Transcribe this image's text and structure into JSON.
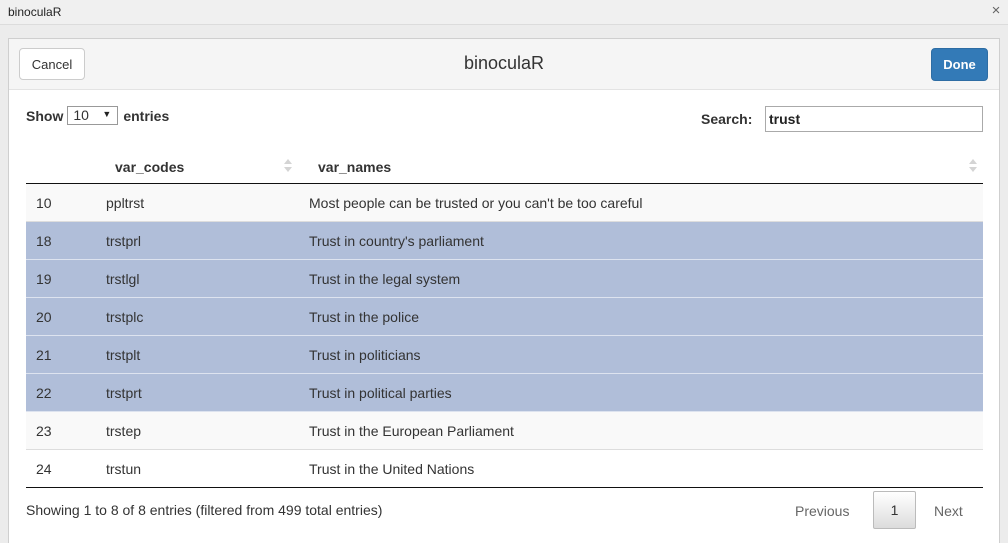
{
  "window": {
    "title": "binoculaR",
    "close_glyph": "×"
  },
  "gadget": {
    "title": "binoculaR",
    "cancel_label": "Cancel",
    "done_label": "Done"
  },
  "length": {
    "show_label": "Show",
    "selected": "10",
    "entries_label": "entries"
  },
  "search": {
    "label": "Search:",
    "value": "trust"
  },
  "table": {
    "columns": [
      "",
      "var_codes",
      "var_names"
    ],
    "rows": [
      {
        "num": "10",
        "code": "ppltrst",
        "name": "Most people can be trusted or you can't be too careful",
        "selected": false
      },
      {
        "num": "18",
        "code": "trstprl",
        "name": "Trust in country's parliament",
        "selected": true
      },
      {
        "num": "19",
        "code": "trstlgl",
        "name": "Trust in the legal system",
        "selected": true
      },
      {
        "num": "20",
        "code": "trstplc",
        "name": "Trust in the police",
        "selected": true
      },
      {
        "num": "21",
        "code": "trstplt",
        "name": "Trust in politicians",
        "selected": true
      },
      {
        "num": "22",
        "code": "trstprt",
        "name": "Trust in political parties",
        "selected": true
      },
      {
        "num": "23",
        "code": "trstep",
        "name": "Trust in the European Parliament",
        "selected": false
      },
      {
        "num": "24",
        "code": "trstun",
        "name": "Trust in the United Nations",
        "selected": false
      }
    ]
  },
  "info": "Showing 1 to 8 of 8 entries (filtered from 499 total entries)",
  "pagination": {
    "previous": "Previous",
    "current": "1",
    "next": "Next"
  },
  "colors": {
    "selected_row": "#b0bed9",
    "done_button": "#337ab7"
  }
}
